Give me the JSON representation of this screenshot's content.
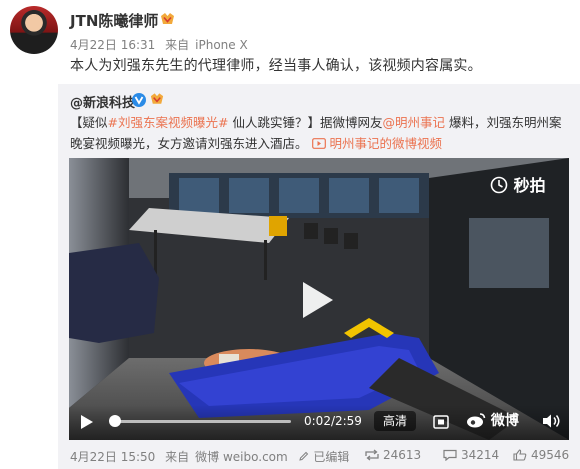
{
  "post": {
    "author": "JTN陈曦律师",
    "date": "4月22日 16:31",
    "source_prefix": "来自",
    "device": "iPhone X",
    "text": "本人为刘强东先生的代理律师，经当事人确认，该视频内容属实。"
  },
  "repost": {
    "source_account": "@新浪科技",
    "text_part1": "【疑似",
    "hashtag": "#刘强东案视频曝光#",
    "text_part2": " 仙人跳实锤？】据微博网友",
    "mention": "@明州事记",
    "text_part3": " 爆料，刘强东明州案晚宴视频曝光，女方邀请刘强东进入酒店。",
    "video_link": "明州事记的微博视频",
    "video": {
      "watermark": "秒拍",
      "time": "0:02/2:59",
      "progress": 0.011,
      "quality": "高清",
      "brand": "微博"
    },
    "footer": {
      "date": "4月22日 15:50",
      "source_prefix": "来自",
      "source": "微博 weibo.com",
      "edited": "已编辑",
      "reposts": "24613",
      "comments": "34214",
      "likes": "49546"
    }
  },
  "colors": {
    "link": "#eb7350",
    "meta": "#808080",
    "repost_bg": "#f2f2f5"
  }
}
